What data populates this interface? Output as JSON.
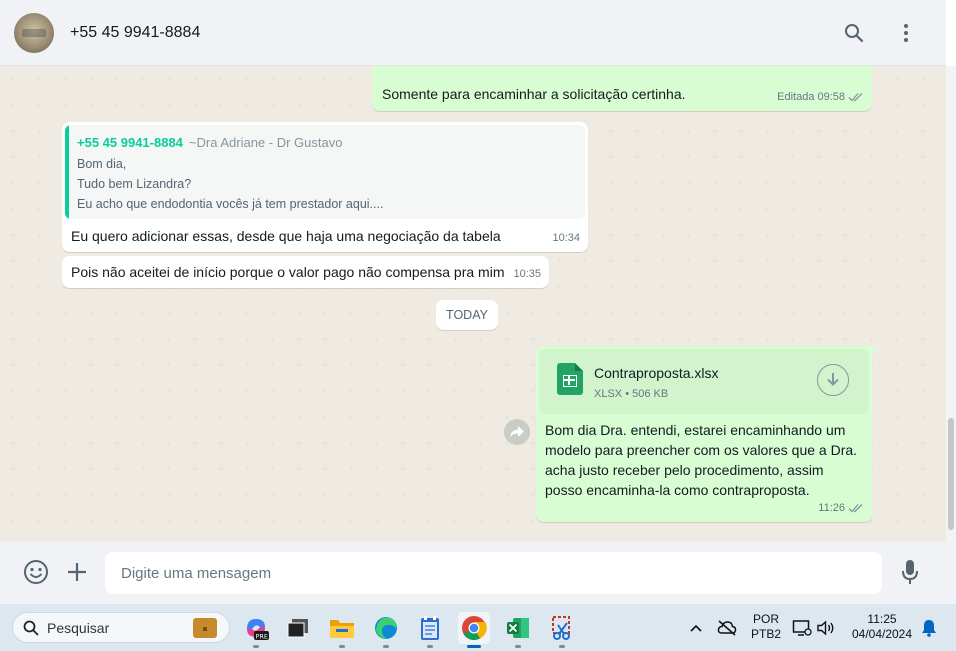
{
  "header": {
    "contact_name": "+55 45 9941-8884"
  },
  "messages": [
    {
      "direction": "out",
      "text": "Somente para encaminhar a solicitação certinha.",
      "edited_label": "Editada",
      "time": "09:58",
      "status": "read"
    },
    {
      "direction": "in",
      "quote": {
        "sender": "+55 45 9941-8884",
        "sender_name": "~Dra Adriane - Dr Gustavo",
        "lines": [
          "Bom dia,",
          "Tudo bem Lizandra?",
          "Eu acho que endodontia vocês já tem prestador aqui...."
        ]
      },
      "text": "Eu quero adicionar essas, desde que haja uma negociação da tabela",
      "time": "10:34"
    },
    {
      "direction": "in",
      "text": "Pois não aceitei de início porque o valor pago não compensa pra mim",
      "time": "10:35"
    },
    {
      "direction": "out",
      "attachment": {
        "name": "Contraproposta.xlsx",
        "type": "XLSX",
        "separator": "•",
        "size": "506 KB"
      },
      "text": "Bom dia Dra. entendi, estarei encaminhando um modelo para preencher com os valores que a Dra. acha justo receber pelo procedimento, assim posso encaminha-la como contraproposta.",
      "time": "11:26",
      "status": "read"
    }
  ],
  "date_divider": "TODAY",
  "composer": {
    "placeholder": "Digite uma mensagem"
  },
  "taskbar": {
    "search_label": "Pesquisar",
    "apps": [
      "copilot-pre",
      "desktop",
      "file-explorer",
      "edge",
      "notepad",
      "chrome",
      "excel",
      "snipping-tool"
    ],
    "active_app": "chrome",
    "tray": {
      "language": "POR",
      "layout": "PTB2",
      "time": "11:25",
      "date": "04/04/2024"
    }
  },
  "colors": {
    "outgoing_bubble": "#d9fdd3",
    "incoming_bubble": "#ffffff",
    "chat_background": "#efeae2",
    "accent": "#06cf9c",
    "read_tick": "#8696a0"
  }
}
